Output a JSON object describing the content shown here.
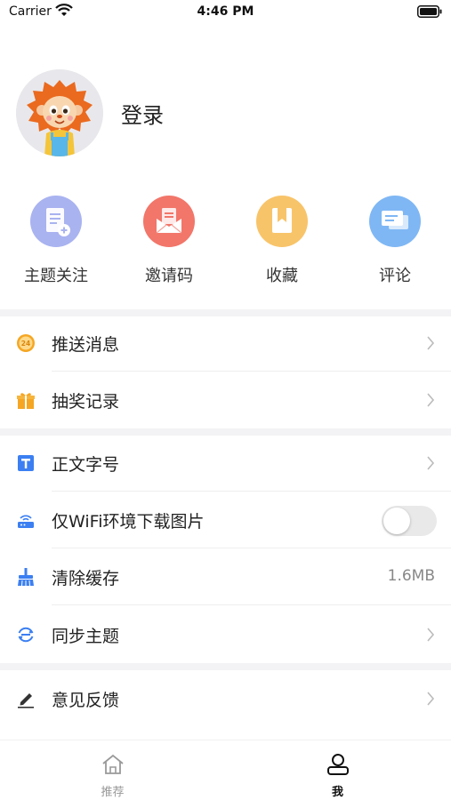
{
  "status_bar": {
    "carrier": "Carrier",
    "time": "4:46 PM"
  },
  "profile": {
    "login_label": "登录",
    "avatar_icon": "lion-mascot-avatar"
  },
  "shortcuts": [
    {
      "label": "主题关注",
      "icon": "document-add-icon",
      "color": "#a9b3f0"
    },
    {
      "label": "邀请码",
      "icon": "envelope-icon",
      "color": "#f2766a"
    },
    {
      "label": "收藏",
      "icon": "bookmark-icon",
      "color": "#f8c46a"
    },
    {
      "label": "评论",
      "icon": "chat-bubbles-icon",
      "color": "#7fb7f4"
    }
  ],
  "menu": {
    "push_messages": {
      "label": "推送消息",
      "icon": "24h-icon"
    },
    "lottery_records": {
      "label": "抽奖记录",
      "icon": "gift-icon"
    },
    "font_size": {
      "label": "正文字号",
      "icon": "text-size-icon"
    },
    "wifi_only_images": {
      "label": "仅WiFi环境下载图片",
      "icon": "router-icon",
      "enabled": false
    },
    "clear_cache": {
      "label": "清除缓存",
      "value": "1.6MB",
      "icon": "broom-icon"
    },
    "sync_topics": {
      "label": "同步主题",
      "icon": "sync-icon"
    },
    "feedback": {
      "label": "意见反馈",
      "icon": "pencil-icon"
    }
  },
  "tab_bar": {
    "home": {
      "label": "推荐",
      "icon": "home-icon"
    },
    "me": {
      "label": "我",
      "icon": "user-icon",
      "selected": true
    }
  },
  "colors": {
    "accent_blue": "#3b7ff2",
    "orange": "#f5a623",
    "separator": "#f3f3f5"
  }
}
